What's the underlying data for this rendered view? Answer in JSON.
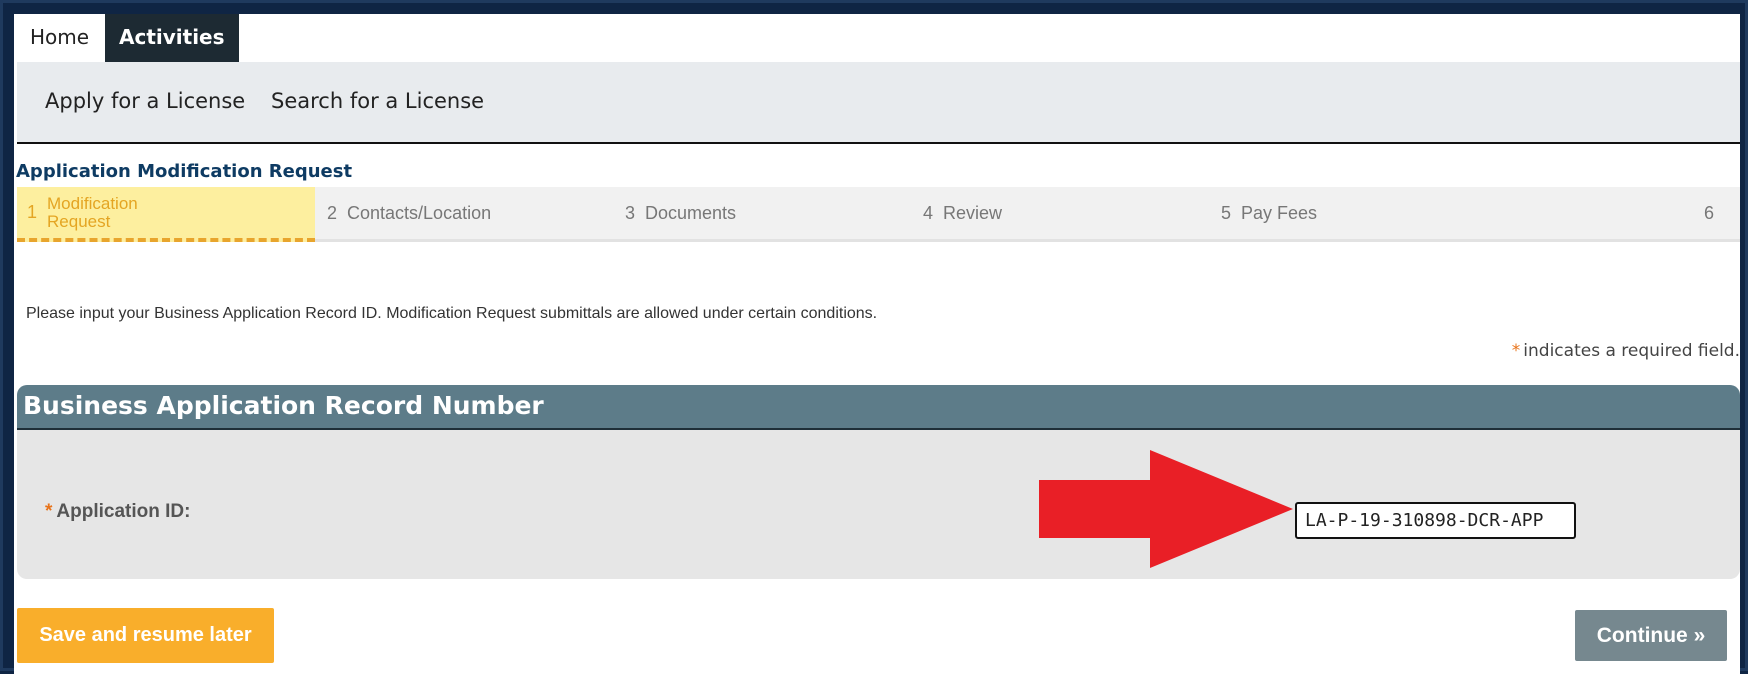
{
  "topnav": {
    "tabs": [
      {
        "label": "Home",
        "active": false
      },
      {
        "label": "Activities",
        "active": true
      }
    ]
  },
  "subnav": {
    "items": [
      {
        "label": "Apply for a License"
      },
      {
        "label": "Search for a License"
      }
    ]
  },
  "page": {
    "title": "Application Modification Request",
    "instructions": "Please input your Business Application Record ID. Modification Request submittals are allowed under certain conditions.",
    "required_star": "*",
    "required_note": "indicates a required field."
  },
  "steps": [
    {
      "num": "1",
      "label": "Modification Request",
      "active": true
    },
    {
      "num": "2",
      "label": "Contacts/Location",
      "active": false
    },
    {
      "num": "3",
      "label": "Documents",
      "active": false
    },
    {
      "num": "4",
      "label": "Review",
      "active": false
    },
    {
      "num": "5",
      "label": "Pay Fees",
      "active": false
    },
    {
      "num": "6",
      "label": "",
      "active": false
    }
  ],
  "section": {
    "title": "Business Application Record Number",
    "field_star": "*",
    "field_label": "Application ID:",
    "field_value": "LA-P-19-310898-DCR-APP"
  },
  "annotation": {
    "arrow_color": "#e91f26"
  },
  "buttons": {
    "save_label": "Save and resume later",
    "continue_label": "Continue »"
  },
  "colors": {
    "accent_orange": "#f9ae2b",
    "step_active_bg": "#fdef9f",
    "section_header_bg": "#5d7c89",
    "title_blue": "#0e3b63",
    "frame_navy": "#0f2544"
  }
}
